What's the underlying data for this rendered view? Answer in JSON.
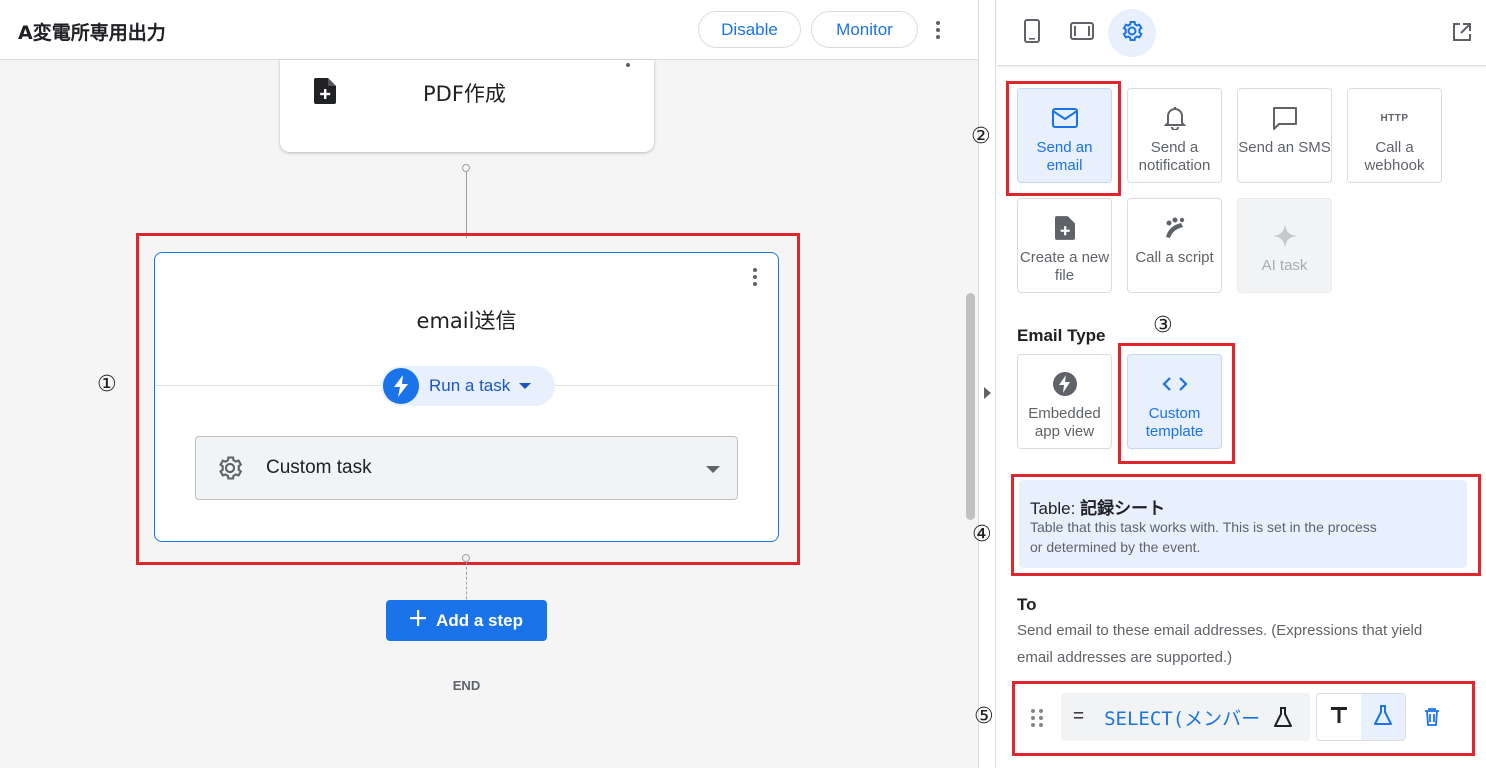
{
  "header": {
    "title": "A変電所専用出力",
    "disable_label": "Disable",
    "monitor_label": "Monitor"
  },
  "canvas": {
    "pdf_step_title": "PDF作成",
    "email_step_title": "email送信",
    "run_task_label": "Run a task",
    "task_select_value": "Custom task",
    "add_step_label": "Add a step",
    "end_label": "END"
  },
  "annotations": [
    "①",
    "②",
    "③",
    "④",
    "⑤"
  ],
  "right_panel": {
    "task_types": [
      {
        "label": "Send an email",
        "icon": "mail-icon",
        "selected": true
      },
      {
        "label": "Send a notification",
        "icon": "bell-icon",
        "selected": false
      },
      {
        "label": "Send an SMS",
        "icon": "message-icon",
        "selected": false
      },
      {
        "label": "Call a webhook",
        "icon": "http-icon",
        "icon_text": "HTTP",
        "selected": false
      },
      {
        "label": "Create a new file",
        "icon": "add-file-icon",
        "selected": false
      },
      {
        "label": "Call a script",
        "icon": "script-icon",
        "selected": false
      },
      {
        "label": "AI task",
        "icon": "sparkle-icon",
        "selected": false,
        "disabled": true
      }
    ],
    "email_type_title": "Email Type",
    "email_types": [
      {
        "label": "Embedded app view",
        "icon": "bolt-icon",
        "selected": false
      },
      {
        "label": "Custom template",
        "icon": "code-icon",
        "selected": true
      }
    ],
    "table_label": "Table:",
    "table_value": "記録シート",
    "table_desc": "Table that this task works with. This is set in the process or determined by the event.",
    "to_title": "To",
    "to_desc": "Send email to these email addresses. (Expressions that yield email addresses are supported.)",
    "expression_prefix": "=",
    "expression_value": "SELECT(メンバー"
  },
  "colors": {
    "accent": "#1a73e8",
    "annotation_red": "#e0262c",
    "selected_bg": "#e8f0fe"
  }
}
